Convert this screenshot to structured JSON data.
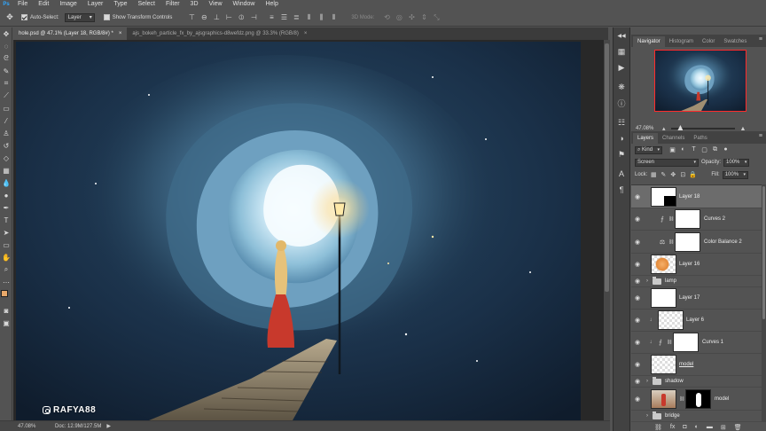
{
  "menubar": {
    "logo": "Ps",
    "items": [
      "File",
      "Edit",
      "Image",
      "Layer",
      "Type",
      "Select",
      "Filter",
      "3D",
      "View",
      "Window",
      "Help"
    ]
  },
  "options": {
    "auto_select_label": "Auto-Select:",
    "auto_select_value": "Layer",
    "show_transform_label": "Show Transform Controls",
    "mode_3d_label": "3D Mode:"
  },
  "tabs": [
    {
      "title": "hole.psd @ 47.1% (Layer 18, RGB/8#) *",
      "close": "×"
    },
    {
      "title": "ajs_bokeh_particle_fx_by_ajsgraphics-d8wefdz.png @ 33.3% (RGB/8)",
      "close": "×"
    }
  ],
  "canvas": {
    "watermark": "RAFYA88"
  },
  "statusbar": {
    "zoom": "47.08%",
    "doc": "Doc: 12.9M/127.5M",
    "arrow": "▶"
  },
  "navigator": {
    "tabs": [
      "Navigator",
      "Histogram",
      "Color",
      "Swatches"
    ],
    "zoom": "47.08%",
    "zoom_slider": 0.12
  },
  "layers_panel": {
    "tabs": [
      "Layers",
      "Channels",
      "Paths"
    ],
    "filter_kind": "Kind",
    "blend_mode": "Screen",
    "opacity_label": "Opacity:",
    "opacity_value": "100%",
    "lock_label": "Lock:",
    "fill_label": "Fill:",
    "fill_value": "100%",
    "layers": [
      {
        "name": "Layer 18",
        "type": "pixel",
        "thumb": "white-black"
      },
      {
        "name": "Curves 2",
        "type": "adjustment",
        "icon": "curves"
      },
      {
        "name": "Color Balance 2",
        "type": "adjustment",
        "icon": "balance"
      },
      {
        "name": "Layer 16",
        "type": "pixel",
        "thumb": "orange"
      },
      {
        "name": "lamp",
        "type": "group"
      },
      {
        "name": "Layer 17",
        "type": "pixel",
        "thumb": "blank"
      },
      {
        "name": "Layer 6",
        "type": "clipped",
        "thumb": "checker"
      },
      {
        "name": "Curves 1",
        "type": "clipped-adjustment",
        "icon": "curves"
      },
      {
        "name": "model",
        "type": "pixel-underlined",
        "thumb": "checker"
      },
      {
        "name": "shadow",
        "type": "group"
      },
      {
        "name": "model",
        "type": "masked",
        "thumb": "photo"
      },
      {
        "name": "bridge",
        "type": "group"
      }
    ]
  }
}
